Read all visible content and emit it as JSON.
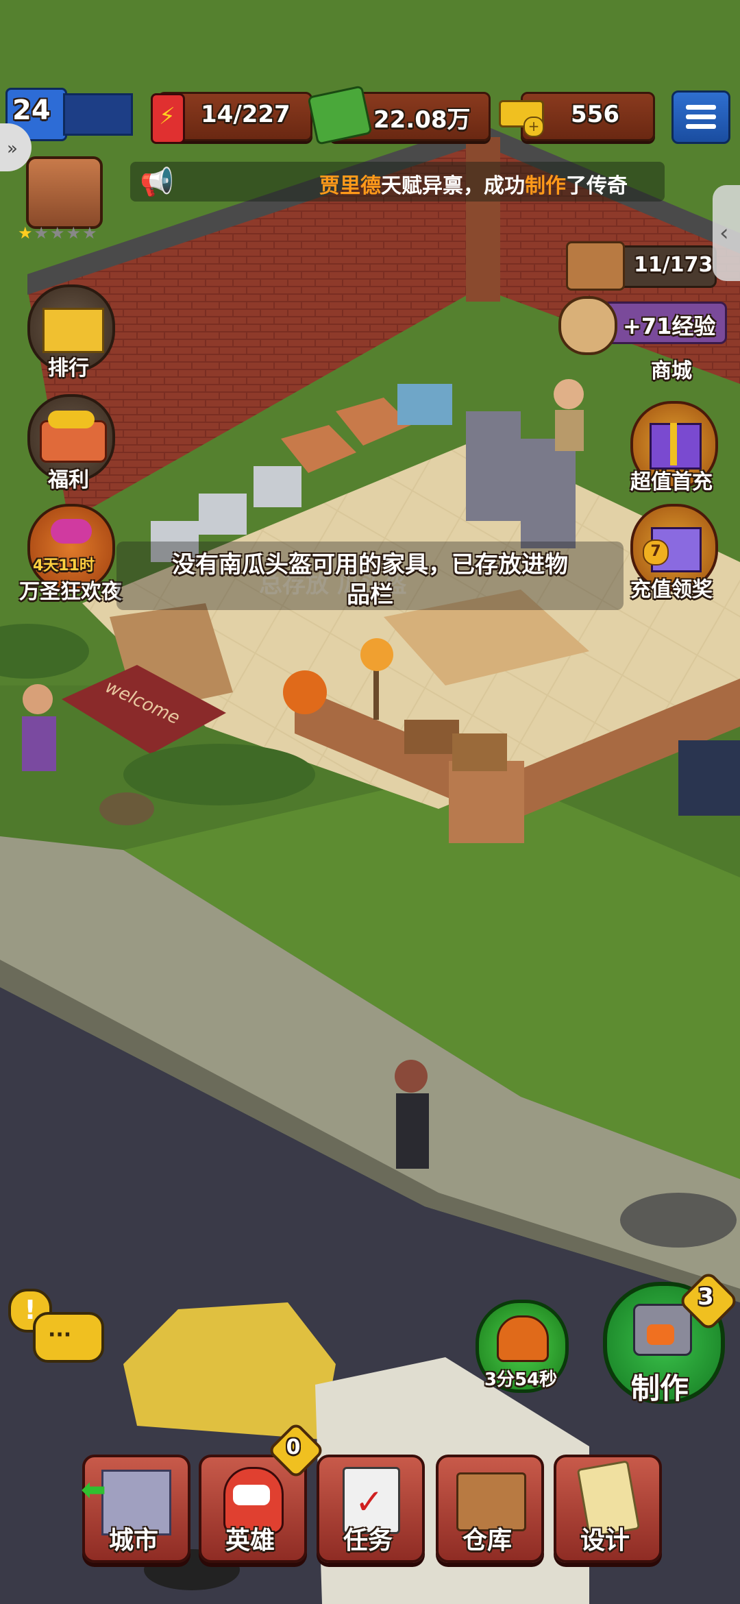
{
  "hud": {
    "level": "24",
    "energy": "14/227",
    "cash": "22.08万",
    "gold": "556"
  },
  "ticker": {
    "name": "贾里德",
    "text_mid": "天赋异禀，成功",
    "text_make": "制作",
    "text_tail": "了传奇"
  },
  "left_menu": {
    "rank": "排行",
    "welfare": "福利",
    "halloween_timer": "4天11时",
    "halloween": "万圣狂欢夜"
  },
  "right_menu": {
    "inventory_count": "11/173",
    "xp_gain": "+71经验",
    "shop": "商城",
    "first_recharge": "超值首充",
    "recharge_reward": "充值领奖",
    "recharge_badge": "7"
  },
  "toast": {
    "line1": "没有南瓜头盔可用的家具，已存放进物",
    "line2": "品栏",
    "ghost": "总存放    瓜头盔"
  },
  "scene": {
    "welcome_mat": "welcome"
  },
  "craft": {
    "timer": "3分54秒",
    "craft_label": "制作",
    "craft_badge": "3"
  },
  "bottom_nav": {
    "city": "城市",
    "heroes": "英雄",
    "heroes_badge": "0",
    "tasks": "任务",
    "warehouse": "仓库",
    "design": "设计"
  },
  "colors": {
    "grass": "#4f7a2c",
    "brick": "#7a2e22",
    "floor": "#d9c79a",
    "road": "#3a3a48",
    "accent_orange": "#ff9a1a"
  }
}
